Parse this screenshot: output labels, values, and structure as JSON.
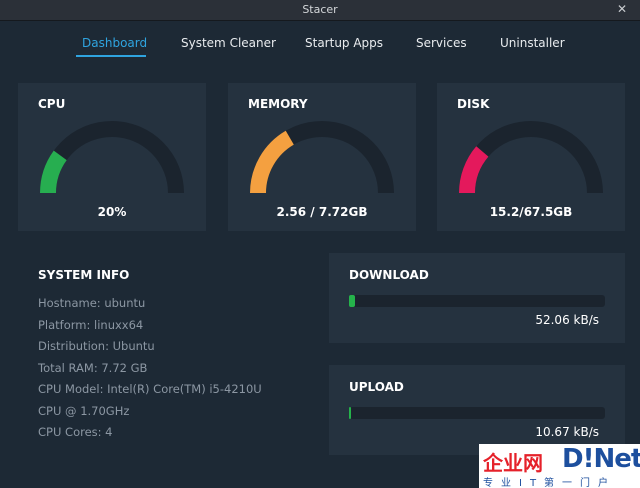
{
  "window": {
    "title": "Stacer",
    "close_glyph": "✕"
  },
  "nav": {
    "tabs": [
      {
        "label": "Dashboard",
        "active": true
      },
      {
        "label": "System Cleaner",
        "active": false
      },
      {
        "label": "Startup Apps",
        "active": false
      },
      {
        "label": "Services",
        "active": false
      },
      {
        "label": "Uninstaller",
        "active": false
      }
    ]
  },
  "gauges": [
    {
      "title": "CPU",
      "value": "20%",
      "fraction": 0.2,
      "color": "#27ae50"
    },
    {
      "title": "MEMORY",
      "value": "2.56 / 7.72GB",
      "fraction": 0.332,
      "color": "#f4a040"
    },
    {
      "title": "DISK",
      "value": "15.2/67.5GB",
      "fraction": 0.225,
      "color": "#e4195c"
    }
  ],
  "system_info": {
    "title": "SYSTEM INFO",
    "rows": [
      "Hostname: ubuntu",
      "Platform: linuxx64",
      "Distribution: Ubuntu",
      "Total RAM: 7.72 GB",
      "CPU Model: Intel(R) Core(TM) i5-4210U",
      "CPU @ 1.70GHz",
      "CPU Cores: 4"
    ]
  },
  "download": {
    "title": "DOWNLOAD",
    "speed": "52.06 kB/s",
    "fraction": 0.025
  },
  "upload": {
    "title": "UPLOAD",
    "speed": "10.67 kB/s",
    "fraction": 0.006
  },
  "watermark": {
    "brand": "企业网",
    "name": "D!Net",
    "tagline": "专业IT第一门户"
  },
  "colors": {
    "accent": "#2fa4e0",
    "background": "#1d2935",
    "panel": "#25323f",
    "track": "#1b242e",
    "progress": "#25b34b"
  }
}
